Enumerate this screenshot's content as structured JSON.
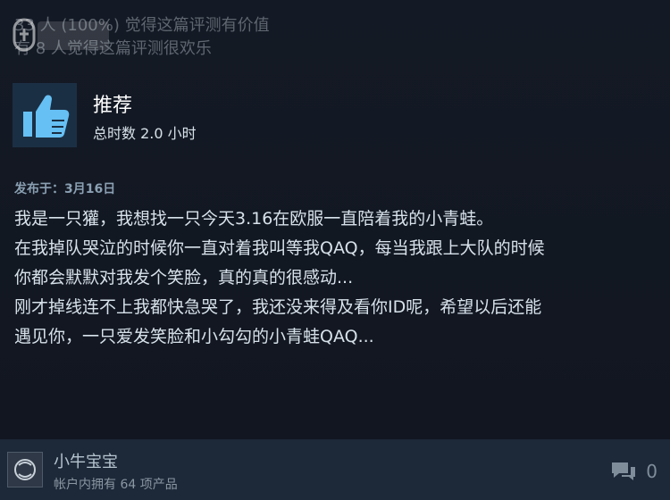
{
  "helpful": {
    "line1": "33 人 (100%) 觉得这篇评测有价值",
    "line2": "有 8 人觉得这篇评测很欢乐"
  },
  "watermark": {
    "text": "游民"
  },
  "review": {
    "verdict": "推荐",
    "hours": "总时数 2.0 小时",
    "posted": "发布于：3月16日",
    "paragraphs": [
      "我是一只獾，我想找一只今天3.16在欧服一直陪着我的小青蛙。",
      "在我掉队哭泣的时候你一直对着我叫等我QAQ，每当我跟上大队的时候",
      "你都会默默对我发个笑脸，真的真的很感动...",
      "刚才掉线连不上我都快急哭了，我还没来得及看你ID呢，希望以后还能",
      "遇见你，一只爱发笑脸和小勾勾的小青蛙QAQ..."
    ]
  },
  "author": {
    "name": "小牛宝宝",
    "products": "帐户内拥有 64 项产品"
  },
  "comments": {
    "count": "0",
    "icon": "speech-bubble-icon"
  },
  "colors": {
    "accent": "#66c0f4",
    "background": "#12161f",
    "footer": "#1d2838"
  }
}
